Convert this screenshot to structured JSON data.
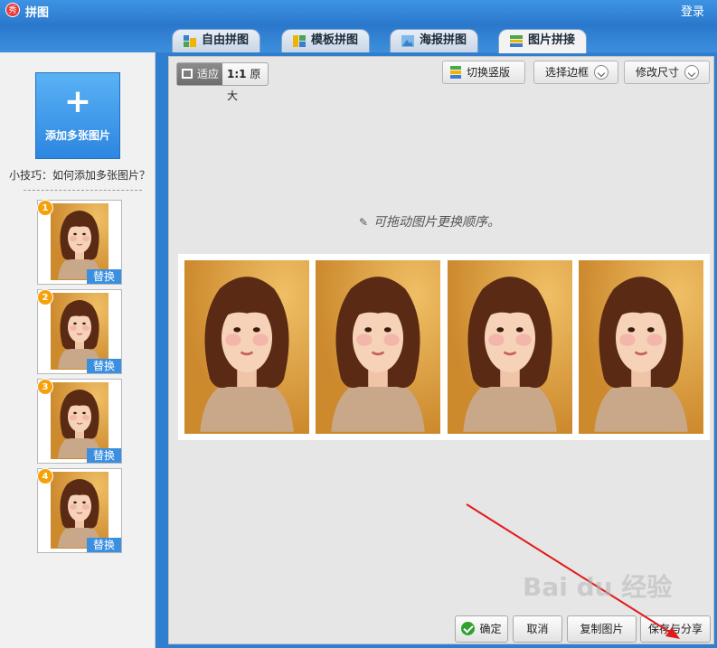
{
  "window": {
    "title": "拼图",
    "login": "登录",
    "logo_text": "秀"
  },
  "tabs": [
    {
      "label": "自由拼图",
      "icon": "free-collage-icon"
    },
    {
      "label": "模板拼图",
      "icon": "template-collage-icon"
    },
    {
      "label": "海报拼图",
      "icon": "poster-collage-icon"
    },
    {
      "label": "图片拼接",
      "icon": "image-stitch-icon",
      "active": true
    }
  ],
  "sidebar": {
    "add_button": {
      "plus": "+",
      "label": "添加多张图片"
    },
    "tip": "小技巧：如何添加多张图片？",
    "thumbnails": [
      {
        "number": "1",
        "replace": "替换"
      },
      {
        "number": "2",
        "replace": "替换"
      },
      {
        "number": "3",
        "replace": "替换"
      },
      {
        "number": "4",
        "replace": "替换"
      }
    ]
  },
  "toolbar": {
    "fit": "适应",
    "original_ratio": "1:1",
    "original": "原大",
    "switch_vertical": "切换竖版",
    "select_border": "选择边框",
    "resize": "修改尺寸"
  },
  "canvas": {
    "hint": "可拖动图片更换顺序。",
    "photo_count": 4
  },
  "actions": {
    "confirm": "确定",
    "cancel": "取消",
    "copy": "复制图片",
    "save_share": "保存与分享"
  },
  "overlay": {
    "watermark": "Bai du 经验"
  },
  "colors": {
    "titlebar": "#2f7fd1",
    "accent": "#3a8fe0",
    "badge": "#f5a20a",
    "arrow": "#e11b1b"
  }
}
